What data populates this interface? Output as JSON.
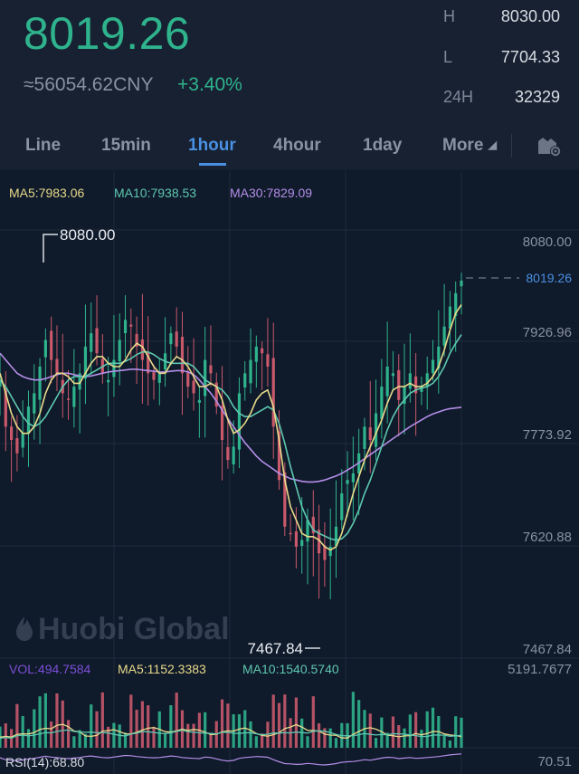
{
  "ticker": {
    "last_price": "8019.26",
    "cny_value": "≈56054.62CNY",
    "change_pct": "+3.40%",
    "stats": [
      {
        "label": "H",
        "value": "8030.00"
      },
      {
        "label": "L",
        "value": "7704.33"
      },
      {
        "label": "24H",
        "value": "32329"
      }
    ]
  },
  "tabs": [
    {
      "label": "Line",
      "active": false
    },
    {
      "label": "15min",
      "active": false
    },
    {
      "label": "1hour",
      "active": true
    },
    {
      "label": "4hour",
      "active": false
    },
    {
      "label": "1day",
      "active": false
    },
    {
      "label": "More",
      "active": false
    }
  ],
  "indicators": {
    "ma5": "MA5:7983.06",
    "ma10": "MA10:7938.53",
    "ma30": "MA30:7829.09",
    "vol": "VOL:494.7584",
    "vol_ma5": "MA5:1152.3383",
    "vol_ma10": "MA10:1540.5740",
    "vol_axis_max": "5191.7677",
    "rsi": "RSI(14):68.80",
    "rsi_axis": "70.51"
  },
  "watermark": "Huobi Global",
  "colors": {
    "up": "#2fb38d",
    "down": "#c8596b",
    "ma5": "#e8d98a",
    "ma10": "#5ec8b0",
    "ma30": "#b48ee8",
    "accent": "#4a90e2"
  },
  "icons": {
    "settings": "settings-icon",
    "more_caret": "caret-down-icon"
  },
  "chart_data": {
    "type": "candlestick",
    "ylim": [
      7467.84,
      8080.0
    ],
    "y_ticks": [
      "8080.00",
      "7926.96",
      "7773.92",
      "7620.88",
      "7467.84"
    ],
    "max_label": "8080.00",
    "min_label": "7467.84",
    "last_price_label": "8019.26",
    "close_path": [
      7870,
      7800,
      7780,
      7760,
      7790,
      7830,
      7850,
      7890,
      7930,
      7900,
      7880,
      7850,
      7840,
      7860,
      7880,
      7920,
      7940,
      7910,
      7880,
      7870,
      7900,
      7930,
      7960,
      7950,
      7920,
      7900,
      7880,
      7870,
      7880,
      7910,
      7940,
      7920,
      7880,
      7860,
      7850,
      7840,
      7900,
      7880,
      7830,
      7780,
      7750,
      7770,
      7850,
      7880,
      7900,
      7920,
      7910,
      7890,
      7800,
      7720,
      7650,
      7640,
      7620,
      7630,
      7660,
      7640,
      7610,
      7600,
      7620,
      7650,
      7700,
      7720,
      7730,
      7760,
      7800,
      7780,
      7820,
      7860,
      7890,
      7880,
      7840,
      7860,
      7880,
      7850,
      7860,
      7880,
      7900,
      7920,
      7950,
      7980,
      8000,
      8019
    ],
    "ma5": [
      7880,
      7850,
      7820,
      7800,
      7790,
      7790,
      7800,
      7820,
      7850,
      7870,
      7880,
      7880,
      7875,
      7865,
      7865,
      7880,
      7895,
      7905,
      7905,
      7895,
      7890,
      7890,
      7900,
      7915,
      7925,
      7920,
      7905,
      7890,
      7880,
      7880,
      7895,
      7905,
      7900,
      7890,
      7875,
      7860,
      7860,
      7865,
      7860,
      7840,
      7810,
      7790,
      7795,
      7805,
      7820,
      7840,
      7850,
      7855,
      7830,
      7780,
      7720,
      7680,
      7660,
      7640,
      7635,
      7635,
      7630,
      7620,
      7615,
      7620,
      7640,
      7670,
      7700,
      7725,
      7750,
      7770,
      7790,
      7810,
      7835,
      7855,
      7860,
      7860,
      7865,
      7860,
      7860,
      7865,
      7875,
      7890,
      7915,
      7945,
      7970,
      7983
    ],
    "ma10": [
      7870,
      7860,
      7845,
      7830,
      7815,
      7805,
      7800,
      7805,
      7815,
      7830,
      7845,
      7860,
      7870,
      7875,
      7875,
      7875,
      7880,
      7885,
      7890,
      7895,
      7895,
      7895,
      7898,
      7902,
      7908,
      7912,
      7912,
      7908,
      7902,
      7898,
      7895,
      7895,
      7895,
      7895,
      7890,
      7880,
      7870,
      7865,
      7860,
      7855,
      7845,
      7830,
      7820,
      7815,
      7815,
      7820,
      7825,
      7830,
      7825,
      7805,
      7775,
      7740,
      7710,
      7680,
      7660,
      7645,
      7640,
      7636,
      7632,
      7630,
      7632,
      7640,
      7655,
      7675,
      7700,
      7720,
      7745,
      7770,
      7795,
      7815,
      7830,
      7840,
      7850,
      7855,
      7858,
      7860,
      7865,
      7875,
      7890,
      7910,
      7925,
      7938
    ],
    "ma30": [
      7910,
      7900,
      7890,
      7880,
      7875,
      7872,
      7870,
      7870,
      7872,
      7875,
      7878,
      7880,
      7880,
      7878,
      7876,
      7875,
      7876,
      7878,
      7880,
      7882,
      7883,
      7884,
      7885,
      7886,
      7886,
      7885,
      7884,
      7883,
      7882,
      7882,
      7883,
      7884,
      7884,
      7882,
      7878,
      7870,
      7860,
      7850,
      7838,
      7825,
      7812,
      7800,
      7788,
      7776,
      7766,
      7756,
      7748,
      7742,
      7736,
      7730,
      7726,
      7722,
      7720,
      7718,
      7717,
      7717,
      7718,
      7720,
      7723,
      7726,
      7730,
      7735,
      7740,
      7746,
      7752,
      7758,
      7764,
      7770,
      7776,
      7782,
      7788,
      7794,
      7800,
      7805,
      7810,
      7815,
      7819,
      7822,
      7825,
      7827,
      7828,
      7829
    ]
  }
}
